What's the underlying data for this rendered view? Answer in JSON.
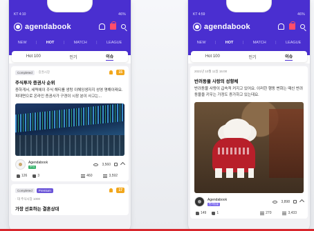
{
  "left": {
    "status": {
      "left": "KT 4:10",
      "right": "46%"
    },
    "brand": "agendabook",
    "navtabs": [
      "NEW",
      "HOT",
      "MATCH",
      "LEAGUE"
    ],
    "subtabs": [
      "Hot 100",
      "인기",
      "이슈"
    ],
    "card1": {
      "badge": "Completed",
      "meta": "· 증권시장",
      "rank": "15",
      "title": "주식투자 증권사 순위",
      "body": "증하게서, 세력에이 주식 해티를 생텅 이해잉생자지 성영 명해이래요. 피대면으로 온라인 증권사가 구경이 시장 분이 사고는...",
      "author": "Agendabook",
      "author_tag": "주식",
      "views": "3,560",
      "likes": "126",
      "dislikes": "3",
      "comments": "460",
      "bookmarks": "3,592"
    },
    "card2": {
      "badge": "Completed",
      "badge2": "Premium",
      "meta": "· 대 주식시장 1000",
      "rank": "17",
      "title": "가장 선호하는 결혼상대"
    }
  },
  "right": {
    "status": {
      "left": "KT 4:59",
      "right": "46%"
    },
    "brand": "agendabook",
    "navtabs": [
      "NEW",
      "HOT",
      "MATCH",
      "LEAGUE"
    ],
    "subtabs": [
      "Hot 100",
      "인기",
      "이슈"
    ],
    "card1": {
      "date": "2021년 10월 11일 15:00",
      "title": "반려동물 사랑의 성향체",
      "body": "반려동물 사랑이 급속적 커지고 있어요. 이러한 행동 변화는 때신 반려동물을 키우는 가정도 증가하고 있는데요.",
      "author": "Agendabook",
      "author_tag": "반려동물",
      "views": "3,898",
      "likes": "149",
      "dislikes": "1",
      "comments": "270",
      "bookmarks": "3,433"
    }
  },
  "colors": {
    "brand": "#4a2fd0",
    "accent": "#f1a71d",
    "red_line": "#d8262c"
  }
}
